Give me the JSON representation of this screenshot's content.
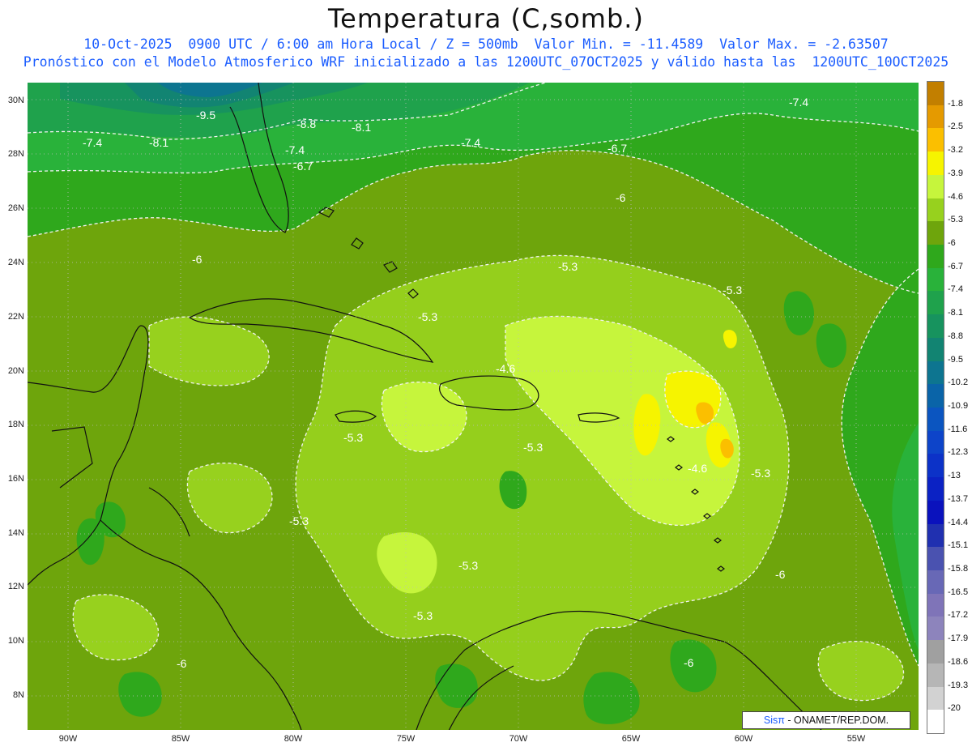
{
  "title": "Temperatura (C,somb.)",
  "header": {
    "line1": "10-Oct-2025  0900 UTC / 6:00 am Hora Local / Z = 500mb  Valor Min. = -11.4589  Valor Max. = -2.63507",
    "line2": "Pronóstico con el Modelo Atmosferico WRF inicializado a las 1200UTC_07OCT2025 y válido hasta las  1200UTC_10OCT2025"
  },
  "lat_labels": [
    "30N",
    "28N",
    "26N",
    "24N",
    "22N",
    "20N",
    "18N",
    "16N",
    "14N",
    "12N",
    "10N",
    "8N"
  ],
  "lon_labels": [
    "90W",
    "85W",
    "80W",
    "75W",
    "70W",
    "65W",
    "60W",
    "55W"
  ],
  "colorbar": {
    "labels": [
      "-1.8",
      "-2.5",
      "-3.2",
      "-3.9",
      "-4.6",
      "-5.3",
      "-6",
      "-6.7",
      "-7.4",
      "-8.1",
      "-8.8",
      "-9.5",
      "-10.2",
      "-10.9",
      "-11.6",
      "-12.3",
      "-13",
      "-13.7",
      "-14.4",
      "-15.1",
      "-15.8",
      "-16.5",
      "-17.2",
      "-17.9",
      "-18.6",
      "-19.3",
      "-20"
    ],
    "colors": [
      "#c27f00",
      "#e59a00",
      "#fbbf00",
      "#f6f400",
      "#c6f53c",
      "#97d11e",
      "#6ea50c",
      "#2fa81c",
      "#29b23a",
      "#1fa24c",
      "#17935e",
      "#128472",
      "#0d7590",
      "#0a64a8",
      "#0b55c0",
      "#0d44c9",
      "#0c32c8",
      "#0b22c4",
      "#0a12bd",
      "#2030b0",
      "#4a52b0",
      "#6868b6",
      "#7f74b8",
      "#8d84bc",
      "#a0a0a0",
      "#b6b6b6",
      "#d2d2d2",
      "#ffffff"
    ]
  },
  "contour_labels": [
    "-9.5",
    "-8.8",
    "-8.1",
    "-7.4",
    "-8.1",
    "-7.4",
    "-6.7",
    "-7.4",
    "-6.7",
    "-7.4",
    "-6",
    "-6",
    "-5.3",
    "-5.3",
    "-5.3",
    "-4.6",
    "-5.3",
    "-5.3",
    "-4.6",
    "-5.3",
    "-5.3",
    "-5.3",
    "-5.3",
    "-6",
    "-6",
    "-6"
  ],
  "credit": {
    "brand": "Sisπ",
    "text": "- ONAMET/REP.DOM."
  }
}
